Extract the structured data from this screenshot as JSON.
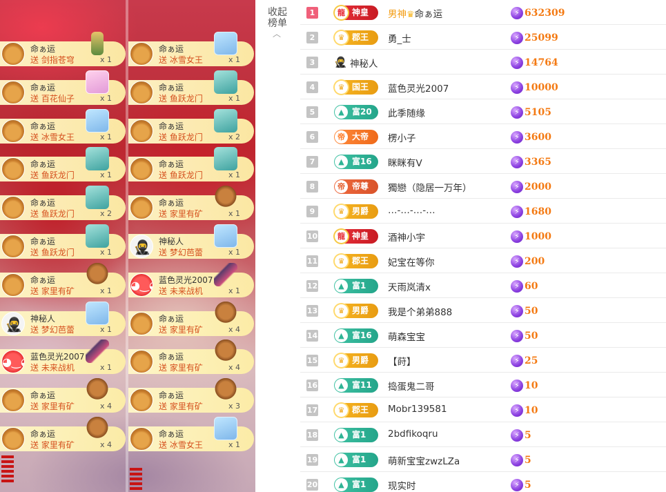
{
  "sidebar": {
    "collapse_label": "收起榜单"
  },
  "feed": {
    "col1": [
      {
        "name": "命ぁ运",
        "text": "送 剑指苍穹",
        "count": "x 1",
        "avatar": "dog-avatar",
        "gift_icon": "sword-figure-icon"
      },
      {
        "name": "命ぁ运",
        "text": "送 百花仙子",
        "count": "x 1",
        "avatar": "dog-avatar",
        "gift_icon": "fairy-icon"
      },
      {
        "name": "命ぁ运",
        "text": "送 冰雪女王",
        "count": "x 1",
        "avatar": "dog-avatar",
        "gift_icon": "ice-queen-icon"
      },
      {
        "name": "命ぁ运",
        "text": "送 鱼跃龙门",
        "count": "x 1",
        "avatar": "dog-avatar",
        "gift_icon": "castle-icon"
      },
      {
        "name": "命ぁ运",
        "text": "送 鱼跃龙门",
        "count": "x 2",
        "avatar": "dog-avatar",
        "gift_icon": "castle-icon"
      },
      {
        "name": "命ぁ运",
        "text": "送 鱼跃龙门",
        "count": "x 1",
        "avatar": "dog-avatar",
        "gift_icon": "castle-icon"
      },
      {
        "name": "命ぁ运",
        "text": "送 家里有矿",
        "count": "x 1",
        "avatar": "dog-avatar",
        "gift_icon": "bear-icon"
      },
      {
        "name": "神秘人",
        "text": "送 梦幻芭蕾",
        "count": "x 1",
        "avatar": "ninja-avatar",
        "gift_icon": "ballet-icon"
      },
      {
        "name": "蓝色灵光2007",
        "text": "送 未来战机",
        "count": "x 1",
        "avatar": "red-face-avatar",
        "gift_icon": "jet-icon"
      },
      {
        "name": "命ぁ运",
        "text": "送 家里有矿",
        "count": "x 4",
        "avatar": "dog-avatar",
        "gift_icon": "bear-icon"
      },
      {
        "name": "命ぁ运",
        "text": "送 家里有矿",
        "count": "x 4",
        "avatar": "dog-avatar",
        "gift_icon": "bear-icon"
      }
    ],
    "col2": [
      {
        "name": "命ぁ运",
        "text": "送 冰雪女王",
        "count": "x 1",
        "avatar": "dog-avatar",
        "gift_icon": "ice-queen-icon"
      },
      {
        "name": "命ぁ运",
        "text": "送 鱼跃龙门",
        "count": "x 1",
        "avatar": "dog-avatar",
        "gift_icon": "castle-icon"
      },
      {
        "name": "命ぁ运",
        "text": "送 鱼跃龙门",
        "count": "x 2",
        "avatar": "dog-avatar",
        "gift_icon": "castle-icon"
      },
      {
        "name": "命ぁ运",
        "text": "送 鱼跃龙门",
        "count": "x 1",
        "avatar": "dog-avatar",
        "gift_icon": "castle-icon"
      },
      {
        "name": "命ぁ运",
        "text": "送 家里有矿",
        "count": "x 1",
        "avatar": "dog-avatar",
        "gift_icon": "bear-icon"
      },
      {
        "name": "神秘人",
        "text": "送 梦幻芭蕾",
        "count": "x 1",
        "avatar": "ninja-avatar",
        "gift_icon": "ballet-icon"
      },
      {
        "name": "蓝色灵光2007",
        "text": "送 未来战机",
        "count": "x 1",
        "avatar": "red-face-avatar",
        "gift_icon": "jet-icon"
      },
      {
        "name": "命ぁ运",
        "text": "送 家里有矿",
        "count": "x 4",
        "avatar": "dog-avatar",
        "gift_icon": "bear-icon"
      },
      {
        "name": "命ぁ运",
        "text": "送 家里有矿",
        "count": "x 4",
        "avatar": "dog-avatar",
        "gift_icon": "bear-icon"
      },
      {
        "name": "命ぁ运",
        "text": "送 家里有矿",
        "count": "x 3",
        "avatar": "dog-avatar",
        "gift_icon": "bear-icon"
      },
      {
        "name": "命ぁ运",
        "text": "送 冰雪女王",
        "count": "x 1",
        "avatar": "dog-avatar",
        "gift_icon": "ice-queen-icon"
      }
    ]
  },
  "ranking": [
    {
      "rank": "1",
      "badge": "神皇",
      "badge_style": "red",
      "badge_icon": "dragon-icon",
      "name": "男神",
      "name_suffix": "命ぁ运",
      "score": "632309",
      "vip": true
    },
    {
      "rank": "2",
      "badge": "郡王",
      "badge_style": "gold",
      "badge_icon": "crown-icon",
      "name": "勇_士",
      "score": "25099"
    },
    {
      "rank": "3",
      "badge": "",
      "badge_style": "none",
      "badge_icon": "ninja-icon",
      "name": "神秘人",
      "score": "14764"
    },
    {
      "rank": "4",
      "badge": "国王",
      "badge_style": "gold",
      "badge_icon": "crown-icon",
      "name": "蓝色灵光2007",
      "score": "10000"
    },
    {
      "rank": "5",
      "badge": "富20",
      "badge_style": "teal",
      "badge_icon": "rich-icon",
      "name": "此季随缘",
      "score": "5105"
    },
    {
      "rank": "6",
      "badge": "大帝",
      "badge_style": "orange",
      "badge_icon": "emperor-icon",
      "name": "楞小子",
      "score": "3600"
    },
    {
      "rank": "7",
      "badge": "富16",
      "badge_style": "teal",
      "badge_icon": "rich-icon",
      "name": "眯眯有V",
      "score": "3365"
    },
    {
      "rank": "8",
      "badge": "帝尊",
      "badge_style": "coral",
      "badge_icon": "emperor-icon",
      "name": "獨戀（隐居一万年）",
      "score": "2000"
    },
    {
      "rank": "9",
      "badge": "男爵",
      "badge_style": "gold",
      "badge_icon": "crown-icon",
      "name": "…-…-…-…",
      "score": "1680"
    },
    {
      "rank": "10",
      "badge": "神皇",
      "badge_style": "red",
      "badge_icon": "dragon-icon",
      "name": "酒神小宇",
      "score": "1000"
    },
    {
      "rank": "11",
      "badge": "郡王",
      "badge_style": "gold",
      "badge_icon": "crown-icon",
      "name": "妃宝在等你",
      "score": "200"
    },
    {
      "rank": "12",
      "badge": "富1",
      "badge_style": "teal",
      "badge_icon": "rich-icon",
      "name": "天雨岚清x",
      "score": "60"
    },
    {
      "rank": "13",
      "badge": "男爵",
      "badge_style": "gold",
      "badge_icon": "crown-icon",
      "name": "我是个弟弟888",
      "score": "50"
    },
    {
      "rank": "14",
      "badge": "富16",
      "badge_style": "teal",
      "badge_icon": "rich-icon",
      "name": "萌森宝宝",
      "score": "50"
    },
    {
      "rank": "15",
      "badge": "男爵",
      "badge_style": "gold",
      "badge_icon": "crown-icon",
      "name": "【莳】",
      "score": "25"
    },
    {
      "rank": "16",
      "badge": "富11",
      "badge_style": "teal",
      "badge_icon": "rich-icon",
      "name": "捣蛋鬼二哥",
      "score": "10"
    },
    {
      "rank": "17",
      "badge": "郡王",
      "badge_style": "gold",
      "badge_icon": "crown-icon",
      "name": "Mobr139581",
      "score": "10"
    },
    {
      "rank": "18",
      "badge": "富1",
      "badge_style": "teal",
      "badge_icon": "rich-icon",
      "name": "2bdfikoqru",
      "score": "5"
    },
    {
      "rank": "19",
      "badge": "富1",
      "badge_style": "teal",
      "badge_icon": "rich-icon",
      "name": "萌新宝宝zwzLZa",
      "score": "5"
    },
    {
      "rank": "20",
      "badge": "富1",
      "badge_style": "teal",
      "badge_icon": "rich-icon",
      "name": "现实时",
      "score": "5"
    }
  ]
}
